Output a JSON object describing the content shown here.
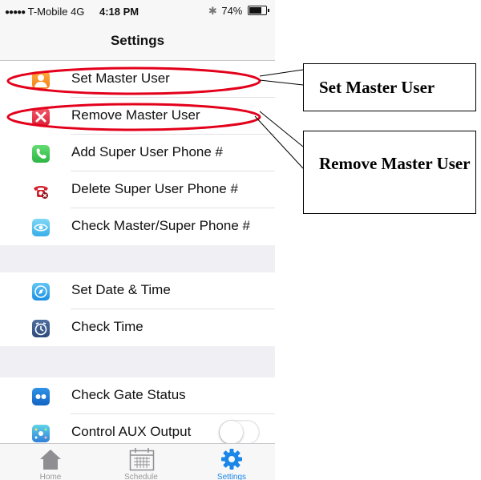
{
  "status_bar": {
    "signal": "●●●●●",
    "carrier": "T-Mobile",
    "network": "4G",
    "time": "4:18 PM",
    "bluetooth": "✱",
    "battery": "74%"
  },
  "nav": {
    "title": "Settings"
  },
  "groups": [
    {
      "rows": [
        {
          "label": "Set Master User",
          "icon": "person-icon"
        },
        {
          "label": "Remove Master User",
          "icon": "x-icon"
        },
        {
          "label": "Add Super User Phone #",
          "icon": "phone-icon"
        },
        {
          "label": "Delete Super User Phone #",
          "icon": "red-phone-icon"
        },
        {
          "label": "Check Master/Super Phone #",
          "icon": "eye-icon"
        }
      ]
    },
    {
      "rows": [
        {
          "label": "Set Date & Time",
          "icon": "compass-icon"
        },
        {
          "label": "Check Time",
          "icon": "clock-icon"
        }
      ]
    },
    {
      "rows": [
        {
          "label": "Check Gate Status",
          "icon": "dots-icon"
        },
        {
          "label": "Control AUX Output",
          "icon": "sparkle-icon",
          "toggle_on": false
        }
      ]
    }
  ],
  "tabs": [
    {
      "label": "Home",
      "icon": "home-icon",
      "active": false
    },
    {
      "label": "Schedule",
      "icon": "calendar-icon",
      "active": false
    },
    {
      "label": "Settings",
      "icon": "gear-icon",
      "active": true
    }
  ],
  "annotations": [
    {
      "text": "Set Master User"
    },
    {
      "text": "Remove Master User"
    }
  ],
  "colors": {
    "accent": "#1a87e8",
    "annotation_ellipse": "#e3001b"
  }
}
